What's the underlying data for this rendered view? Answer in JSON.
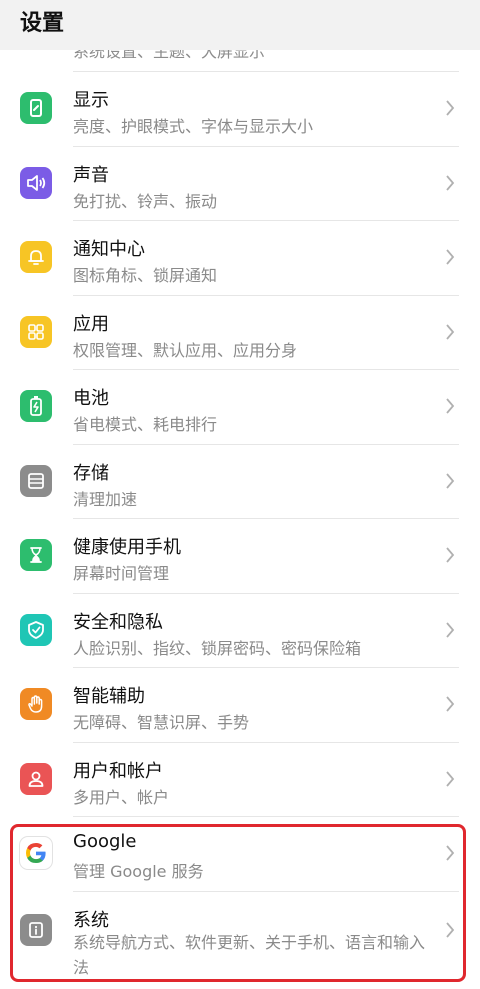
{
  "header": {
    "title": "设置"
  },
  "partial_item": {
    "subtitle": "系统设置、主题、大屏显示"
  },
  "items": [
    {
      "title": "显示",
      "subtitle": "亮度、护眼模式、字体与显示大小",
      "icon": "display-icon",
      "color": "#2dbd6e"
    },
    {
      "title": "声音",
      "subtitle": "免打扰、铃声、振动",
      "icon": "speaker-icon",
      "color": "#7b5ce6"
    },
    {
      "title": "通知中心",
      "subtitle": "图标角标、锁屏通知",
      "icon": "bell-icon",
      "color": "#f7c525"
    },
    {
      "title": "应用",
      "subtitle": "权限管理、默认应用、应用分身",
      "icon": "apps-grid-icon",
      "color": "#f7c525"
    },
    {
      "title": "电池",
      "subtitle": "省电模式、耗电排行",
      "icon": "battery-icon",
      "color": "#2dbd6e"
    },
    {
      "title": "存储",
      "subtitle": "清理加速",
      "icon": "storage-icon",
      "color": "#8c8c8c"
    },
    {
      "title": "健康使用手机",
      "subtitle": "屏幕时间管理",
      "icon": "hourglass-icon",
      "color": "#2dbd6e"
    },
    {
      "title": "安全和隐私",
      "subtitle": "人脸识别、指纹、锁屏密码、密码保险箱",
      "icon": "shield-icon",
      "color": "#1fc6b5"
    },
    {
      "title": "智能辅助",
      "subtitle": "无障碍、智慧识屏、手势",
      "icon": "hand-icon",
      "color": "#f08a24"
    },
    {
      "title": "用户和帐户",
      "subtitle": "多用户、帐户",
      "icon": "user-icon",
      "color": "#ea5455"
    },
    {
      "title": "Google",
      "subtitle": "管理 Google 服务",
      "icon": "google-icon",
      "color": "#ffffff"
    },
    {
      "title": "系统",
      "subtitle": "系统导航方式、软件更新、关于手机、语言和输入法",
      "icon": "info-icon",
      "color": "#8c8c8c"
    }
  ]
}
